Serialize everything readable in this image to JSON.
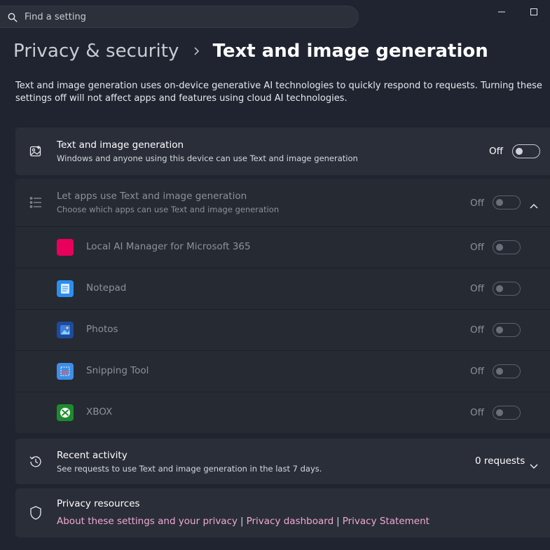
{
  "search": {
    "placeholder": "Find a setting"
  },
  "window": {
    "minimize_icon": "minimize-icon",
    "maximize_icon": "maximize-icon"
  },
  "breadcrumb": {
    "parent": "Privacy & security",
    "current": "Text and image generation"
  },
  "description": "Text and image generation uses on-device generative AI technologies to quickly respond to requests. Turning these settings off will not affect apps and features using cloud AI technologies.",
  "main_setting": {
    "title": "Text and image generation",
    "subtitle": "Windows and anyone using this device can use Text and image generation",
    "state": "Off",
    "icon": "image-generation-icon"
  },
  "apps_setting": {
    "title": "Let apps use Text and image generation",
    "subtitle": "Choose which apps can use Text and image generation",
    "state": "Off",
    "icon": "list-icon",
    "apps": [
      {
        "name": "Local AI Manager for Microsoft 365",
        "state": "Off",
        "icon_color": "#e8005a"
      },
      {
        "name": "Notepad",
        "state": "Off",
        "icon_color": "#2b8ef0"
      },
      {
        "name": "Photos",
        "state": "Off",
        "icon_color": "#1d4a9c"
      },
      {
        "name": "Snipping Tool",
        "state": "Off",
        "icon_color": "#3d8ee6"
      },
      {
        "name": "XBOX",
        "state": "Off",
        "icon_color": "#1e8a2e"
      }
    ]
  },
  "recent_activity": {
    "title": "Recent activity",
    "subtitle": "See requests to use Text and image generation in the last 7 days.",
    "count": "0 requests",
    "icon": "history-icon"
  },
  "privacy_resources": {
    "title": "Privacy resources",
    "links": [
      "About these settings and your privacy",
      "Privacy dashboard",
      "Privacy Statement"
    ],
    "separator": "|",
    "icon": "shield-icon"
  }
}
